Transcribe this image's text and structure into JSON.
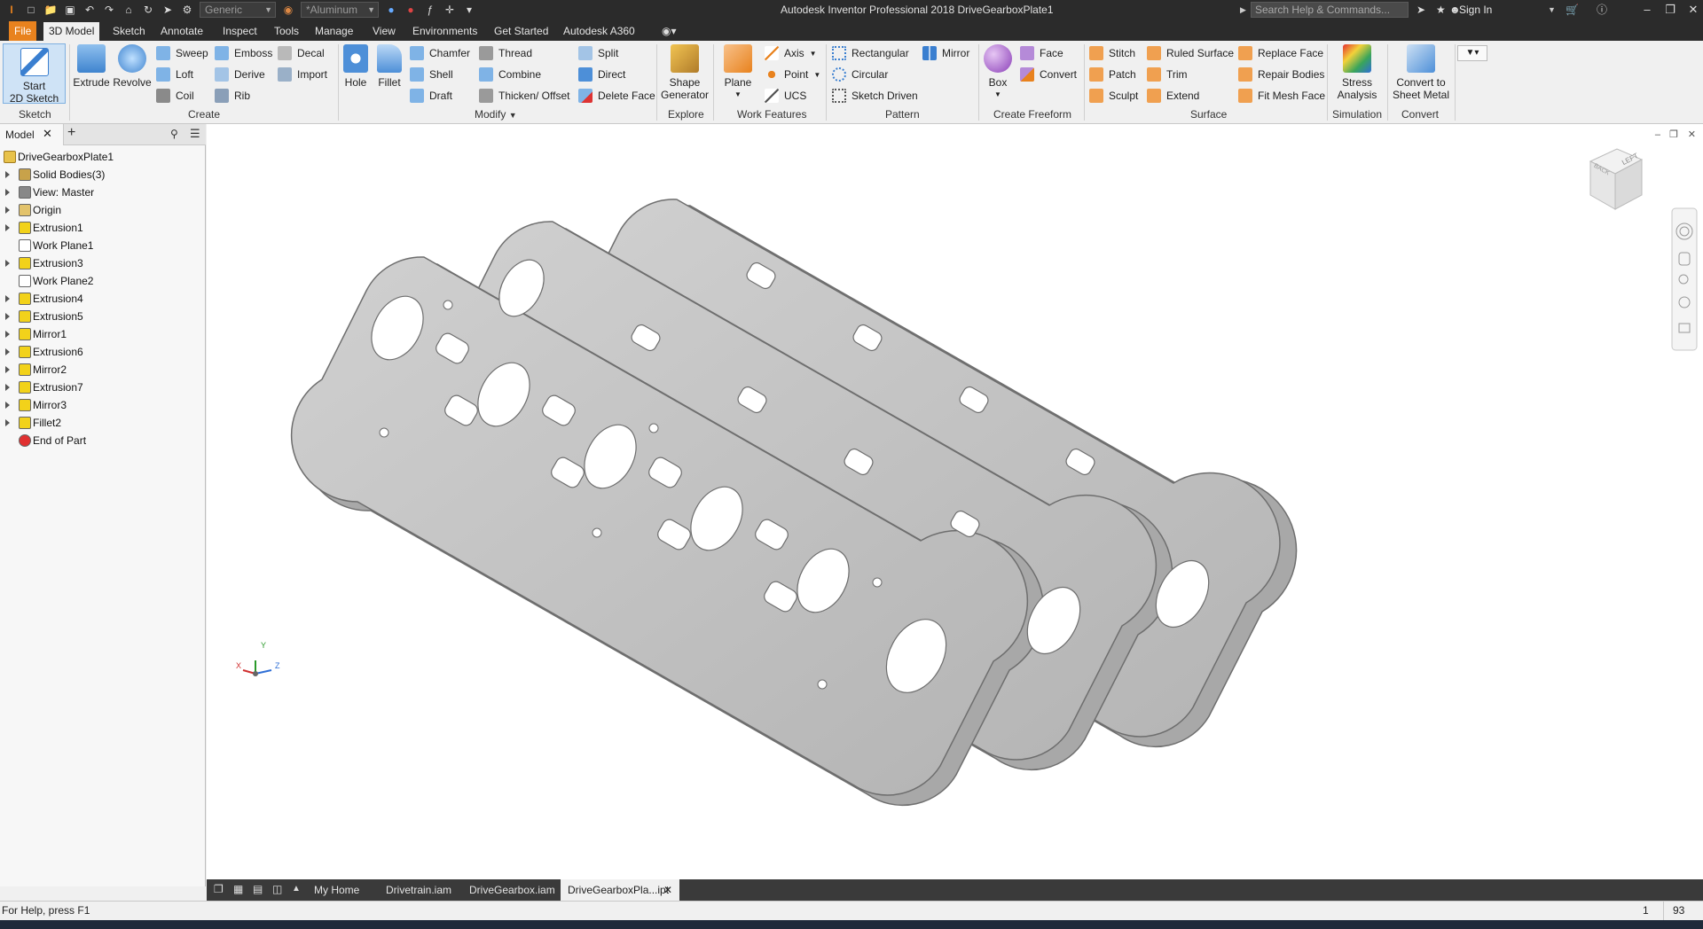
{
  "app": {
    "title": "Autodesk Inventor Professional 2018   DriveGearboxPlate1",
    "appearance_combo": "Generic",
    "material_combo": "*Aluminum",
    "search_placeholder": "Search Help & Commands...",
    "sign_in": "Sign In"
  },
  "menu_tabs": [
    "File",
    "3D Model",
    "Sketch",
    "Annotate",
    "Inspect",
    "Tools",
    "Manage",
    "View",
    "Environments",
    "Get Started",
    "Autodesk A360"
  ],
  "ribbon": {
    "sketch": {
      "start_sketch_line1": "Start",
      "start_sketch_line2": "2D Sketch",
      "panel": "Sketch"
    },
    "create": {
      "extrude": "Extrude",
      "revolve": "Revolve",
      "sweep": "Sweep",
      "emboss": "Emboss",
      "decal": "Decal",
      "loft": "Loft",
      "derive": "Derive",
      "import": "Import",
      "coil": "Coil",
      "rib": "Rib",
      "panel": "Create"
    },
    "modify": {
      "hole": "Hole",
      "fillet": "Fillet",
      "chamfer": "Chamfer",
      "thread": "Thread",
      "split": "Split",
      "shell": "Shell",
      "combine": "Combine",
      "direct": "Direct",
      "draft": "Draft",
      "thicken": "Thicken/ Offset",
      "delete_face": "Delete Face",
      "panel": "Modify"
    },
    "explore": {
      "shape_line1": "Shape",
      "shape_line2": "Generator",
      "panel": "Explore"
    },
    "work_features": {
      "plane": "Plane",
      "axis": "Axis",
      "point": "Point",
      "ucs": "UCS",
      "panel": "Work Features"
    },
    "pattern": {
      "rectangular": "Rectangular",
      "mirror": "Mirror",
      "circular": "Circular",
      "sketch_driven": "Sketch Driven",
      "panel": "Pattern"
    },
    "freeform": {
      "box": "Box",
      "face": "Face",
      "convert": "Convert",
      "panel": "Create Freeform"
    },
    "surface": {
      "stitch": "Stitch",
      "ruled": "Ruled Surface",
      "replace": "Replace Face",
      "patch": "Patch",
      "trim": "Trim",
      "repair": "Repair Bodies",
      "sculpt": "Sculpt",
      "extend": "Extend",
      "fit_mesh": "Fit Mesh Face",
      "panel": "Surface"
    },
    "simulation": {
      "stress_line1": "Stress",
      "stress_line2": "Analysis",
      "panel": "Simulation"
    },
    "convert": {
      "line1": "Convert to",
      "line2": "Sheet Metal",
      "panel": "Convert"
    }
  },
  "browser": {
    "tab": "Model",
    "root": "DriveGearboxPlate1",
    "items": [
      {
        "label": "Solid Bodies(3)",
        "icon": "solid-bodies",
        "color": "#c8a24a"
      },
      {
        "label": "View: Master",
        "icon": "view",
        "color": "#888888"
      },
      {
        "label": "Origin",
        "icon": "folder",
        "color": "#e3c36b"
      },
      {
        "label": "Extrusion1",
        "icon": "extrusion",
        "color": "#f2d21a"
      },
      {
        "label": "Work Plane1",
        "icon": "work-plane",
        "color": "#ffffff"
      },
      {
        "label": "Extrusion3",
        "icon": "extrusion",
        "color": "#f2d21a"
      },
      {
        "label": "Work Plane2",
        "icon": "work-plane",
        "color": "#ffffff"
      },
      {
        "label": "Extrusion4",
        "icon": "extrusion",
        "color": "#f2d21a"
      },
      {
        "label": "Extrusion5",
        "icon": "extrusion",
        "color": "#f2d21a"
      },
      {
        "label": "Mirror1",
        "icon": "mirror",
        "color": "#f2d21a"
      },
      {
        "label": "Extrusion6",
        "icon": "extrusion",
        "color": "#f2d21a"
      },
      {
        "label": "Mirror2",
        "icon": "mirror",
        "color": "#f2d21a"
      },
      {
        "label": "Extrusion7",
        "icon": "extrusion",
        "color": "#f2d21a"
      },
      {
        "label": "Mirror3",
        "icon": "mirror",
        "color": "#f2d21a"
      },
      {
        "label": "Fillet2",
        "icon": "fillet",
        "color": "#f2d21a"
      },
      {
        "label": "End of Part",
        "icon": "end-of-part",
        "color": "#e03030"
      }
    ]
  },
  "doc_tabs": [
    "My Home",
    "Drivetrain.iam",
    "DriveGearbox.iam",
    "DriveGearboxPla...ipt"
  ],
  "status": {
    "help": "For Help, press F1",
    "count1": "1",
    "count2": "93"
  },
  "viewcube": {
    "face1": "LEFT",
    "face2": "BACK"
  },
  "triad": {
    "x": "X",
    "y": "Y",
    "z": "Z"
  },
  "colors": {
    "accent": "#e8821e",
    "ribbon_bg": "#f0f0f0",
    "title_bg": "#2b2b2b",
    "part": "#bdbdbd"
  }
}
